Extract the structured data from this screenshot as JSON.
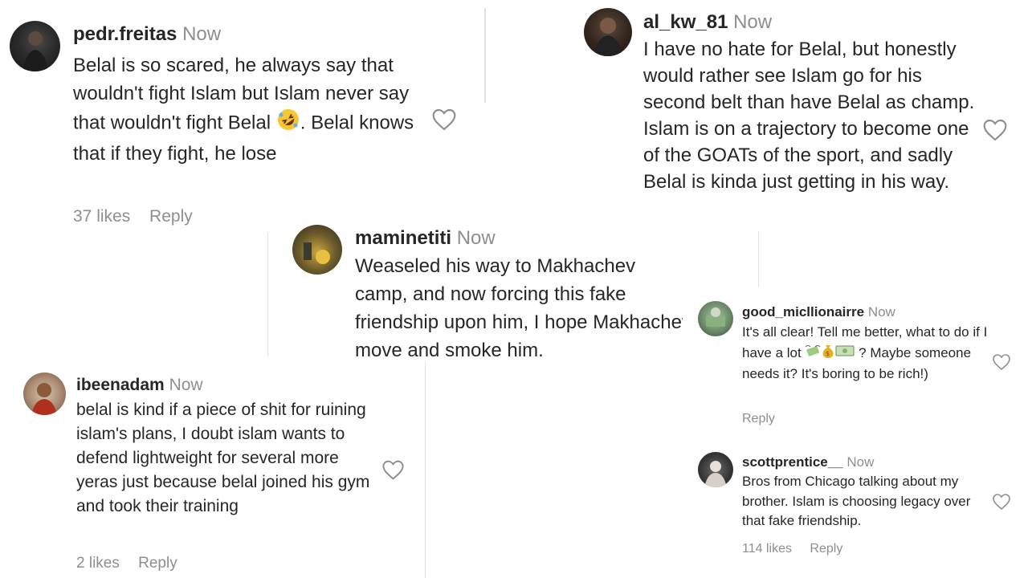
{
  "comments": [
    {
      "username": "pedr.freitas",
      "time": "Now",
      "text_before_emoji": "Belal is so scared, he always say that wouldn't fight Islam but Islam never say that wouldn't fight Belal ",
      "text_after_emoji": ". Belal knows that if they fight, he lose",
      "emoji": "rolling-on-floor-laughing-emoji",
      "likes": "37 likes",
      "reply": "Reply"
    },
    {
      "username": "al_kw_81",
      "time": "Now",
      "text": "I have no hate for Belal, but honestly would rather see Islam go for his second belt than have Belal as champ. Islam is on a trajectory to become one of the GOATs of the sport, and sadly Belal is kinda just getting in his way."
    },
    {
      "username": "maminetiti",
      "time": "Now",
      "text": "Weaseled his way to Makhachev camp, and now forcing this fake friendship upon him, I hope Makhachev move and smoke him."
    },
    {
      "username": "ibeenadam",
      "time": "Now",
      "text": "belal is kind if a piece of shit for ruining islam's plans, I doubt islam wants to defend lightweight for several more yeras just because belal joined his gym and took their training",
      "likes": "2 likes",
      "reply": "Reply"
    },
    {
      "username": "good_micllionairre",
      "time": "Now",
      "text_before_emoji": "It's all clear! Tell me better, what to do if I have a lot ",
      "text_after_emoji": " ? Maybe someone needs it? It's boring to be rich!)",
      "emojis": [
        "money-with-wings-emoji",
        "money-bag-emoji",
        "banknote-emoji"
      ],
      "reply": "Reply"
    },
    {
      "username": "scottprentice__",
      "time": "Now",
      "text": "Bros from Chicago talking about my brother. Islam is choosing legacy over that fake friendship.",
      "likes": "114 likes",
      "reply": "Reply"
    }
  ],
  "colors": {
    "text": "#262626",
    "muted": "#8e8e8e",
    "heart": "#8e8e8e"
  },
  "icons": {
    "like": "heart-outline-icon"
  }
}
